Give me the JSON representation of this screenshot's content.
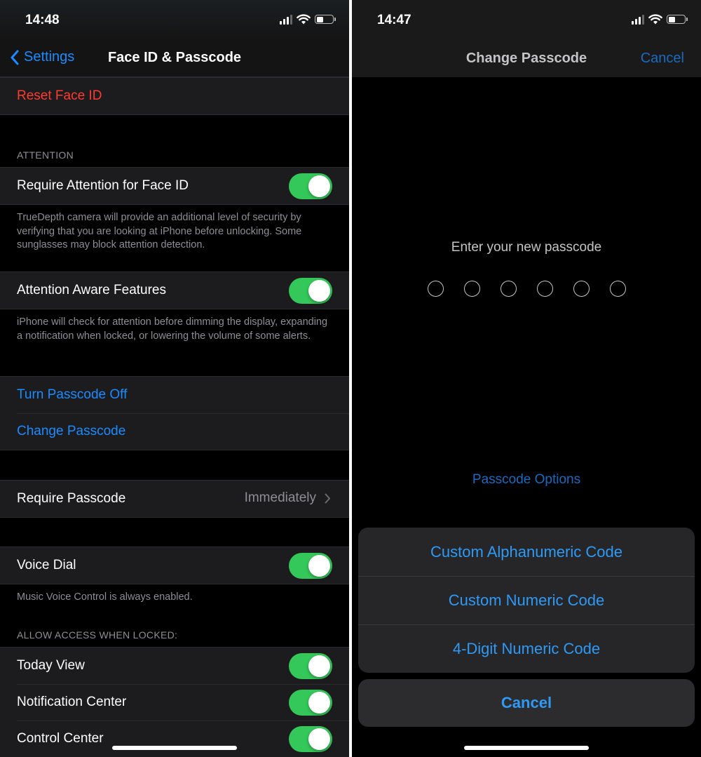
{
  "left": {
    "status": {
      "time": "14:48"
    },
    "nav": {
      "back_label": "Settings",
      "title": "Face ID & Passcode"
    },
    "reset_face_id": "Reset Face ID",
    "attention": {
      "header": "ATTENTION",
      "require_attention": {
        "label": "Require Attention for Face ID",
        "on": true
      },
      "require_attention_footer": "TrueDepth camera will provide an additional level of security by verifying that you are looking at iPhone before unlocking. Some sunglasses may block attention detection.",
      "aware_features": {
        "label": "Attention Aware Features",
        "on": true
      },
      "aware_footer": "iPhone will check for attention before dimming the display, expanding a notification when locked, or lowering the volume of some alerts."
    },
    "passcode": {
      "turn_off": "Turn Passcode Off",
      "change": "Change Passcode"
    },
    "require_passcode": {
      "label": "Require Passcode",
      "value": "Immediately"
    },
    "voice_dial": {
      "label": "Voice Dial",
      "on": true,
      "footer": "Music Voice Control is always enabled."
    },
    "locked_access": {
      "header": "ALLOW ACCESS WHEN LOCKED:",
      "items": [
        {
          "label": "Today View",
          "on": true
        },
        {
          "label": "Notification Center",
          "on": true
        },
        {
          "label": "Control Center",
          "on": true
        }
      ]
    }
  },
  "right": {
    "status": {
      "time": "14:47"
    },
    "title": "Change Passcode",
    "cancel": "Cancel",
    "prompt": "Enter your new passcode",
    "passcode_length": 6,
    "options_link": "Passcode Options",
    "sheet": {
      "options": [
        "Custom Alphanumeric Code",
        "Custom Numeric Code",
        "4-Digit Numeric Code"
      ],
      "cancel": "Cancel"
    }
  },
  "icons": [
    "chevron-left-icon",
    "chevron-right-icon",
    "cellular-signal-icon",
    "wifi-icon",
    "battery-icon"
  ],
  "colors": {
    "accent_blue": "#1a8cff",
    "destructive_red": "#ff3b30",
    "toggle_green": "#34c759"
  }
}
